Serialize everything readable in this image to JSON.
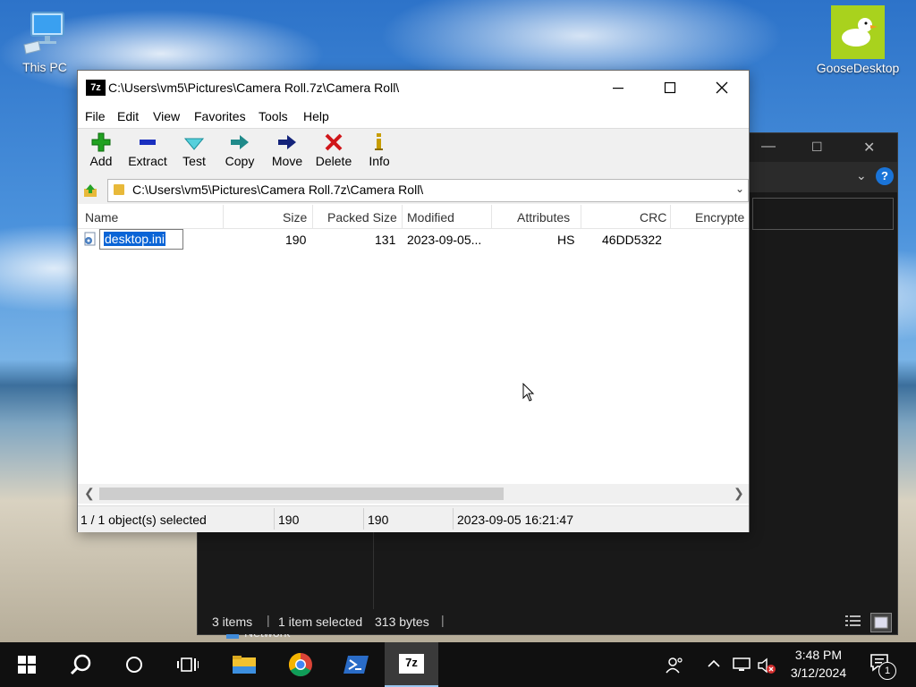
{
  "desktop": {
    "icons": [
      {
        "label": "This PC",
        "icon": "computer-icon"
      },
      {
        "label": "GooseDesktop",
        "icon": "goose-icon"
      }
    ]
  },
  "explorer": {
    "nav_item": "Network",
    "status": {
      "items": "3 items",
      "selected": "1 item selected",
      "size": "313 bytes"
    }
  },
  "sevenzip": {
    "app_icon_text": "7z",
    "title": "C:\\Users\\vm5\\Pictures\\Camera Roll.7z\\Camera Roll\\",
    "menu": [
      "File",
      "Edit",
      "View",
      "Favorites",
      "Tools",
      "Help"
    ],
    "toolbar": [
      {
        "label": "Add",
        "icon": "plus-icon",
        "color": "#21a121"
      },
      {
        "label": "Extract",
        "icon": "minus-icon",
        "color": "#1a2fbf"
      },
      {
        "label": "Test",
        "icon": "check-icon",
        "color": "#25b6c6"
      },
      {
        "label": "Copy",
        "icon": "copy-arrow-icon",
        "color": "#1f8a8a"
      },
      {
        "label": "Move",
        "icon": "move-arrow-icon",
        "color": "#14237a"
      },
      {
        "label": "Delete",
        "icon": "delete-x-icon",
        "color": "#d0161a"
      },
      {
        "label": "Info",
        "icon": "info-icon",
        "color": "#c79d00"
      }
    ],
    "address": "C:\\Users\\vm5\\Pictures\\Camera Roll.7z\\Camera Roll\\",
    "columns": [
      "Name",
      "Size",
      "Packed Size",
      "Modified",
      "Attributes",
      "CRC",
      "Encrypte"
    ],
    "rows": [
      {
        "name": "desktop.ini",
        "size": "190",
        "packed": "131",
        "modified": "2023-09-05...",
        "attributes": "HS",
        "crc": "46DD5322"
      }
    ],
    "status": {
      "selection": "1 / 1 object(s) selected",
      "size": "190",
      "packed": "190",
      "modified": "2023-09-05 16:21:47"
    }
  },
  "taskbar": {
    "items": [
      "start-icon",
      "search-icon",
      "cortana-icon",
      "task-view-icon",
      "file-explorer-icon",
      "chrome-icon",
      "powershell-icon",
      "7zip-icon"
    ],
    "active_app_text": "7z",
    "clock": {
      "time": "3:48 PM",
      "date": "3/12/2024"
    },
    "notification_count": "1"
  }
}
